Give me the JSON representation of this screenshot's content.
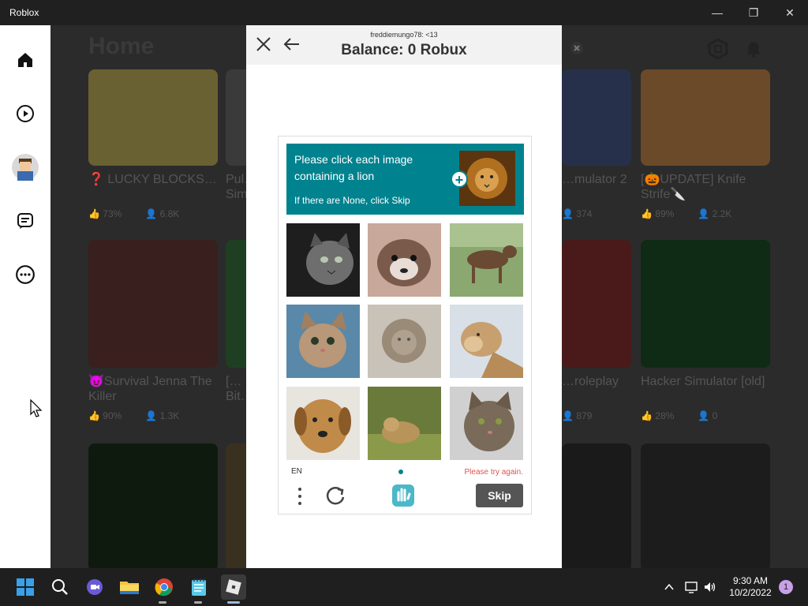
{
  "window": {
    "title": "Roblox",
    "minimize_glyph": "—",
    "maximize_glyph": "❐",
    "close_glyph": "✕"
  },
  "nav": {
    "items": [
      {
        "name": "home",
        "icon": "home-icon"
      },
      {
        "name": "discover",
        "icon": "play-icon"
      },
      {
        "name": "avatar",
        "icon": "avatar-icon"
      },
      {
        "name": "chat",
        "icon": "chat-icon"
      },
      {
        "name": "more",
        "icon": "more-icon"
      }
    ]
  },
  "home": {
    "title": "Home",
    "games": [
      {
        "name": "❓ LUCKY BLOCKS…",
        "rating": "73%",
        "players": "6.8K",
        "color": "#d4c14a"
      },
      {
        "name": "Pul… Sim…",
        "rating": "",
        "players": "",
        "color": "#3a3a3a"
      },
      {
        "name": "…mulator 2",
        "rating": "",
        "players": "374",
        "color": "#2c3e66"
      },
      {
        "name": "[🎃UPDATE] Knife Strife🔪",
        "rating": "89%",
        "players": "2.2K",
        "color": "#e8a04a"
      },
      {
        "name": "😈Survival Jenna The Killer",
        "rating": "90%",
        "players": "1.3K",
        "color": "#b03a3a"
      },
      {
        "name": "[… Bit…",
        "rating": "",
        "players": "",
        "color": "#2f8a3a"
      },
      {
        "name": "…roleplay",
        "rating": "",
        "players": "879",
        "color": "#c0392b"
      },
      {
        "name": "Hacker Simulator [old]",
        "rating": "28%",
        "players": "0",
        "color": "#0f5a1f"
      }
    ]
  },
  "modal": {
    "username": "freddiemungo78: <13",
    "balance": "Balance: 0 Robux"
  },
  "captcha": {
    "prompt": "Please click each image containing a lion",
    "sub": "If there are None, click Skip",
    "plus": "+",
    "language": "EN",
    "error": "Please try again.",
    "skip_label": "Skip",
    "tiles": [
      {
        "label": "cat"
      },
      {
        "label": "puppy"
      },
      {
        "label": "dog"
      },
      {
        "label": "kitten"
      },
      {
        "label": "lion"
      },
      {
        "label": "lioness"
      },
      {
        "label": "dog"
      },
      {
        "label": "lion cub"
      },
      {
        "label": "cat"
      }
    ]
  },
  "taskbar": {
    "time": "9:30 AM",
    "date": "10/2/2022",
    "notification_count": "1",
    "apps": [
      "start-icon",
      "search-icon",
      "teams-icon",
      "file-explorer-icon",
      "chrome-icon",
      "notepad-icon",
      "roblox-icon"
    ]
  }
}
